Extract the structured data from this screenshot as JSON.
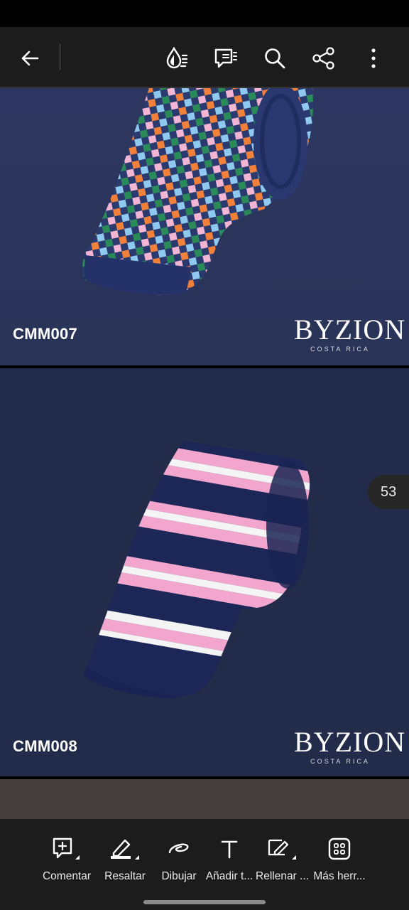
{
  "toolbar": {
    "back_icon": "arrow-left-icon",
    "icons": [
      "color-drop-icon",
      "comment-list-icon",
      "search-icon",
      "share-icon",
      "more-vertical-icon"
    ]
  },
  "pages": [
    {
      "code": "CMM007",
      "logo": {
        "main": "BYZION",
        "sub": "COSTA RICA"
      }
    },
    {
      "code": "CMM008",
      "logo": {
        "main": "BYZION",
        "sub": "COSTA RICA"
      }
    }
  ],
  "page_indicator": "53",
  "tools": [
    {
      "label": "Comentar",
      "icon": "comment-add-icon"
    },
    {
      "label": "Resaltar",
      "icon": "highlighter-icon"
    },
    {
      "label": "Dibujar",
      "icon": "draw-icon"
    },
    {
      "label": "Añadir t...",
      "icon": "text-icon"
    },
    {
      "label": "Rellenar ...",
      "icon": "fill-sign-icon"
    },
    {
      "label": "Más herr...",
      "icon": "more-tools-icon"
    }
  ],
  "colors": {
    "page_bg_1": "#2c3660",
    "page_bg_2": "#222b4a",
    "toolbar": "#1c1c1c"
  }
}
